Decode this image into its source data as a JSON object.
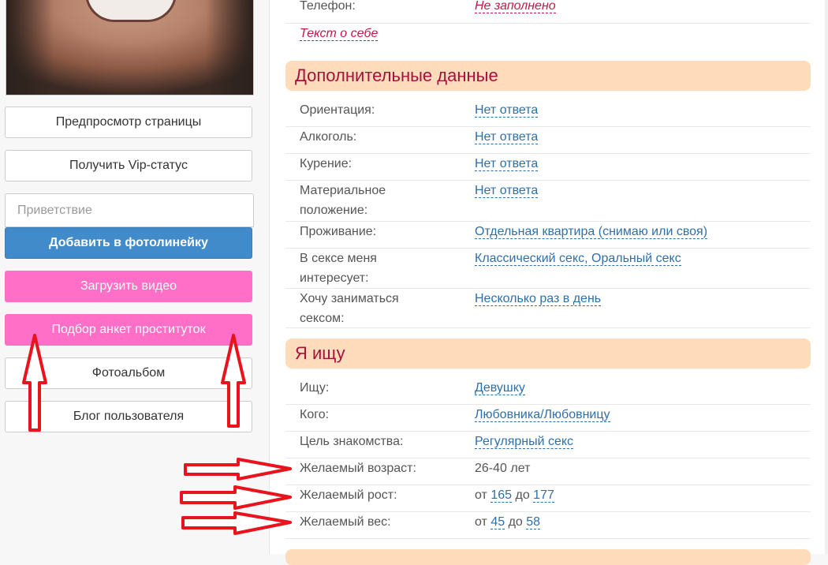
{
  "sidebar": {
    "buttons": {
      "preview": "Предпросмотр страницы",
      "vip": "Получить Vip-статус",
      "add_photoline": "Добавить в фотолинейку",
      "upload_video": "Загрузить видео",
      "escort_search": "Подбор анкет проституток",
      "photoalbum": "Фотоальбом",
      "blog": "Блог пользователя"
    },
    "greeting_placeholder": "Приветствие"
  },
  "profile": {
    "phone": {
      "label": "Телефон:",
      "value": "Не заполнено"
    },
    "about": "Текст о себе",
    "additional": {
      "title": "Дополнительные данные",
      "rows": [
        {
          "label": "Ориентация:",
          "value": "Нет ответа"
        },
        {
          "label": "Алкоголь:",
          "value": "Нет ответа"
        },
        {
          "label": "Курение:",
          "value": "Нет ответа"
        },
        {
          "label": "Материальное положение:",
          "value": "Нет ответа"
        },
        {
          "label": "Проживание:",
          "value": "Отдельная квартира (снимаю или своя)"
        },
        {
          "label": "В сексе меня интересует:",
          "value": "Классический секс, Оральный секс"
        },
        {
          "label": "Хочу заниматься сексом:",
          "value": "Несколько раз в день"
        }
      ]
    },
    "looking": {
      "title": "Я ищу",
      "rows": [
        {
          "label": "Ищу:",
          "value": "Девушку"
        },
        {
          "label": "Кого:",
          "value": "Любовника/Любовницу"
        },
        {
          "label": "Цель знакомства:",
          "value": "Регулярный секс"
        }
      ],
      "age": {
        "label": "Желаемый возраст:",
        "value": "26-40 лет"
      },
      "height": {
        "label": "Желаемый рост:",
        "from": "от",
        "min": "165",
        "to": "до",
        "max": "177"
      },
      "weight": {
        "label": "Желаемый вес:",
        "from": "от",
        "min": "45",
        "to": "до",
        "max": "58"
      }
    }
  },
  "colors": {
    "accent": "#a3123b",
    "link": "#2f6fa8",
    "pink": "#ff6ec7",
    "blue": "#428bca",
    "annotation": "#e8131c"
  }
}
